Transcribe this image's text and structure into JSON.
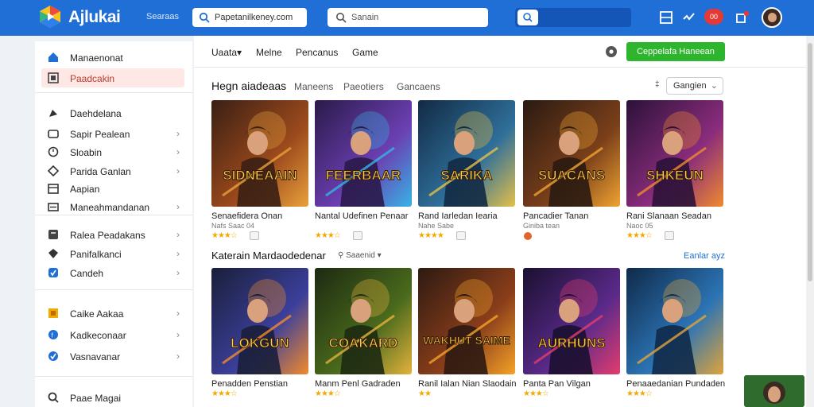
{
  "header": {
    "app_title": "Ajlukai",
    "small_label": "Searaas",
    "search_primary": "Papetanilkeney.com",
    "search_secondary": "Sanain",
    "notif_count": "00"
  },
  "sidebar": {
    "items": [
      {
        "label": "Manaenonat",
        "icon": "home-icon"
      },
      {
        "label": "Paadcakin",
        "icon": "bookmark-icon",
        "active": true
      },
      {
        "label": "Daehdelana",
        "icon": "rocket-icon"
      },
      {
        "label": "Sapir Pealean",
        "icon": "cart-icon",
        "chevron": true
      },
      {
        "label": "Sloabin",
        "icon": "clock-icon",
        "chevron": true
      },
      {
        "label": "Parida Ganlan",
        "icon": "tag-icon",
        "chevron": true
      },
      {
        "label": "Aapian",
        "icon": "calendar-icon"
      },
      {
        "label": "Maneahmandanan",
        "icon": "mail-icon",
        "chevron": true
      },
      {
        "label": "Ralea Peadakans",
        "icon": "list-icon",
        "chevron": true
      },
      {
        "label": "Panifalkanci",
        "icon": "shield-icon",
        "chevron": true
      },
      {
        "label": "Candeh",
        "icon": "check-icon",
        "chevron": true
      },
      {
        "label": "Caike Aakaa",
        "icon": "trophy-icon",
        "chevron": true
      },
      {
        "label": "Kadkeconaar",
        "icon": "flag-icon",
        "chevron": true
      },
      {
        "label": "Vasnavanar",
        "icon": "ok-icon",
        "chevron": true
      },
      {
        "label": "Paae Magai",
        "icon": "chat-icon"
      }
    ]
  },
  "main": {
    "tabs": [
      "Uaata",
      "Melne",
      "Pencanus",
      "Game"
    ],
    "tab_caret": "▾",
    "action_button": "Ceppelafa Haneean",
    "section1": {
      "title": "Hegn aiadeaas",
      "filters": [
        "Maneens",
        "Paeotiers",
        "Gancaens"
      ],
      "sort_label": "Gangien",
      "sort_mark": "‡"
    },
    "section2": {
      "title": "Katerain Mardaodedenar",
      "filter": "Saaenid",
      "see_all": "Eanlar ayz"
    },
    "row1": [
      {
        "title": "Senaefidera Onan",
        "meta": "Nafs Saac 04",
        "stars": "★★★☆",
        "art": "SIDNEAAIN",
        "palette": [
          "#3a1f14",
          "#9c4a1c",
          "#e9a13b"
        ]
      },
      {
        "title": "Nantal Udefinen Penaar",
        "meta": "",
        "stars": "★★★☆",
        "art": "FEERBAAR",
        "palette": [
          "#2a1a4a",
          "#6b3fb1",
          "#37b3e6"
        ]
      },
      {
        "title": "Rand Iarledan Iearia",
        "meta": "Nahe Sabe",
        "stars": "★★★★",
        "art": "SARIKA",
        "palette": [
          "#122a44",
          "#2f6f9a",
          "#e3c04a"
        ]
      },
      {
        "title": "Pancadier Tanan",
        "meta": "Giniba tean",
        "stars": "",
        "art": "SUACANS",
        "palette": [
          "#2a1a12",
          "#7a3f1a",
          "#f0a431"
        ]
      },
      {
        "title": "Rani Slanaan Seadan",
        "meta": "Naoc 05",
        "stars": "★★★☆",
        "art": "SHKEUN",
        "palette": [
          "#2b1238",
          "#8a2c7c",
          "#f08a2e"
        ]
      }
    ],
    "row2": [
      {
        "title": "Penadden Penstian",
        "stars": "★★★☆",
        "art": "LOKGUN",
        "palette": [
          "#1a1f3a",
          "#3b3f9a",
          "#f28b2c"
        ]
      },
      {
        "title": "Manm Penl Gadraden",
        "stars": "★★★☆",
        "art": "COAKARD",
        "palette": [
          "#1d2a12",
          "#4a6a1c",
          "#e3b23c"
        ]
      },
      {
        "title": "Ranil Ialan Nian Slaodain",
        "stars": "★★",
        "art": "WAKHUT SAIME",
        "palette": [
          "#2e1a12",
          "#8a3e1a",
          "#f5a228"
        ]
      },
      {
        "title": "Panta Pan Vilgan",
        "stars": "★★★☆",
        "art": "AURHUNS",
        "palette": [
          "#1a1030",
          "#5a2a8a",
          "#e43c6e"
        ]
      },
      {
        "title": "Penaaedanian Pundaden",
        "stars": "★★★☆",
        "art": "",
        "palette": [
          "#0f2a4a",
          "#2c74b5",
          "#e0a43a"
        ]
      }
    ]
  },
  "colors": {
    "topbar": "#1f6fd6",
    "action_green": "#2db52d",
    "active_bg": "#fde8e5",
    "accent_red": "#e53935",
    "star": "#f2a900"
  }
}
